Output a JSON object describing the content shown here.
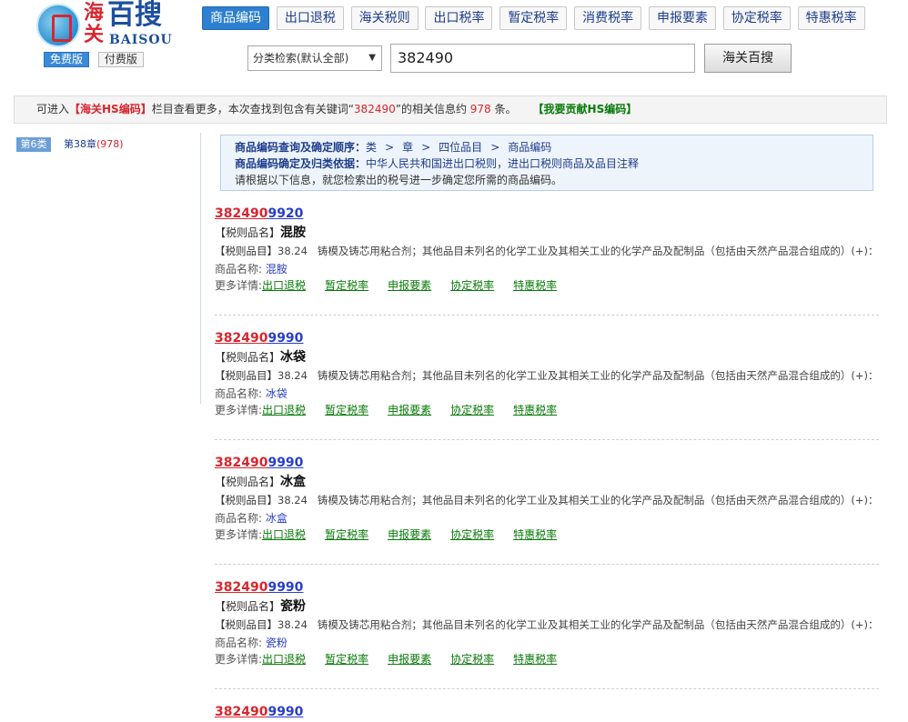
{
  "logo": {
    "cn_left": "海关",
    "cn_right": "百搜",
    "en": "BAISOU"
  },
  "version_buttons": [
    "免费版",
    "付费版"
  ],
  "nav": [
    "商品编码",
    "出口退税",
    "海关税则",
    "出口税率",
    "暂定税率",
    "消费税率",
    "申报要素",
    "协定税率",
    "特惠税率"
  ],
  "search": {
    "select_value": "分类检索(默认全部)",
    "query": "382490",
    "button": "海关百搜"
  },
  "infobar": {
    "prefix": "可进入",
    "link": "【海关HS编码】",
    "middle": "栏目查看更多，本次查找到包含有关键词“",
    "keyword": "382490",
    "middle2": "”的相关信息约",
    "count": "978",
    "suffix": "条。",
    "contribute": "【我要贡献HS编码】"
  },
  "sidebar": {
    "category": "第6类",
    "chapter": "第38章",
    "chapter_count": "(978)"
  },
  "guide": {
    "order_label": "商品编码查询及确定顺序：",
    "order_steps": [
      "类",
      "章",
      "四位品目",
      "商品编码"
    ],
    "basis_label": "商品编码确定及归类依据：",
    "basis_text": "中华人民共和国进出口税则，进出口税则商品及品目注释",
    "note": "请根据以下信息，就您检索出的税号进一步确定您所需的商品编码。"
  },
  "labels": {
    "name_label": "【税则品名】",
    "item_label": "【税则品目】",
    "product_label": "商品名称:",
    "more_label": "更多详情:"
  },
  "detail_links": [
    "出口退税",
    "暂定税率",
    "申报要素",
    "协定税率",
    "特惠税率"
  ],
  "heading_code": "38.24",
  "heading_text": "铸模及铸芯用粘合剂；其他品目未列名的化学工业及其相关工业的化学产品及配制品（包括由天然产品混合组成的）(+)：",
  "results": [
    {
      "code_prefix": "382490",
      "code_suffix": "9920",
      "tariff_name": "混胺",
      "product": "混胺"
    },
    {
      "code_prefix": "382490",
      "code_suffix": "9990",
      "tariff_name": "冰袋",
      "product": "冰袋"
    },
    {
      "code_prefix": "382490",
      "code_suffix": "9990",
      "tariff_name": "冰盒",
      "product": "冰盒"
    },
    {
      "code_prefix": "382490",
      "code_suffix": "9990",
      "tariff_name": "瓷粉",
      "product": "瓷粉"
    },
    {
      "code_prefix": "382490",
      "code_suffix": "9990",
      "tariff_name": "",
      "product": ""
    }
  ]
}
